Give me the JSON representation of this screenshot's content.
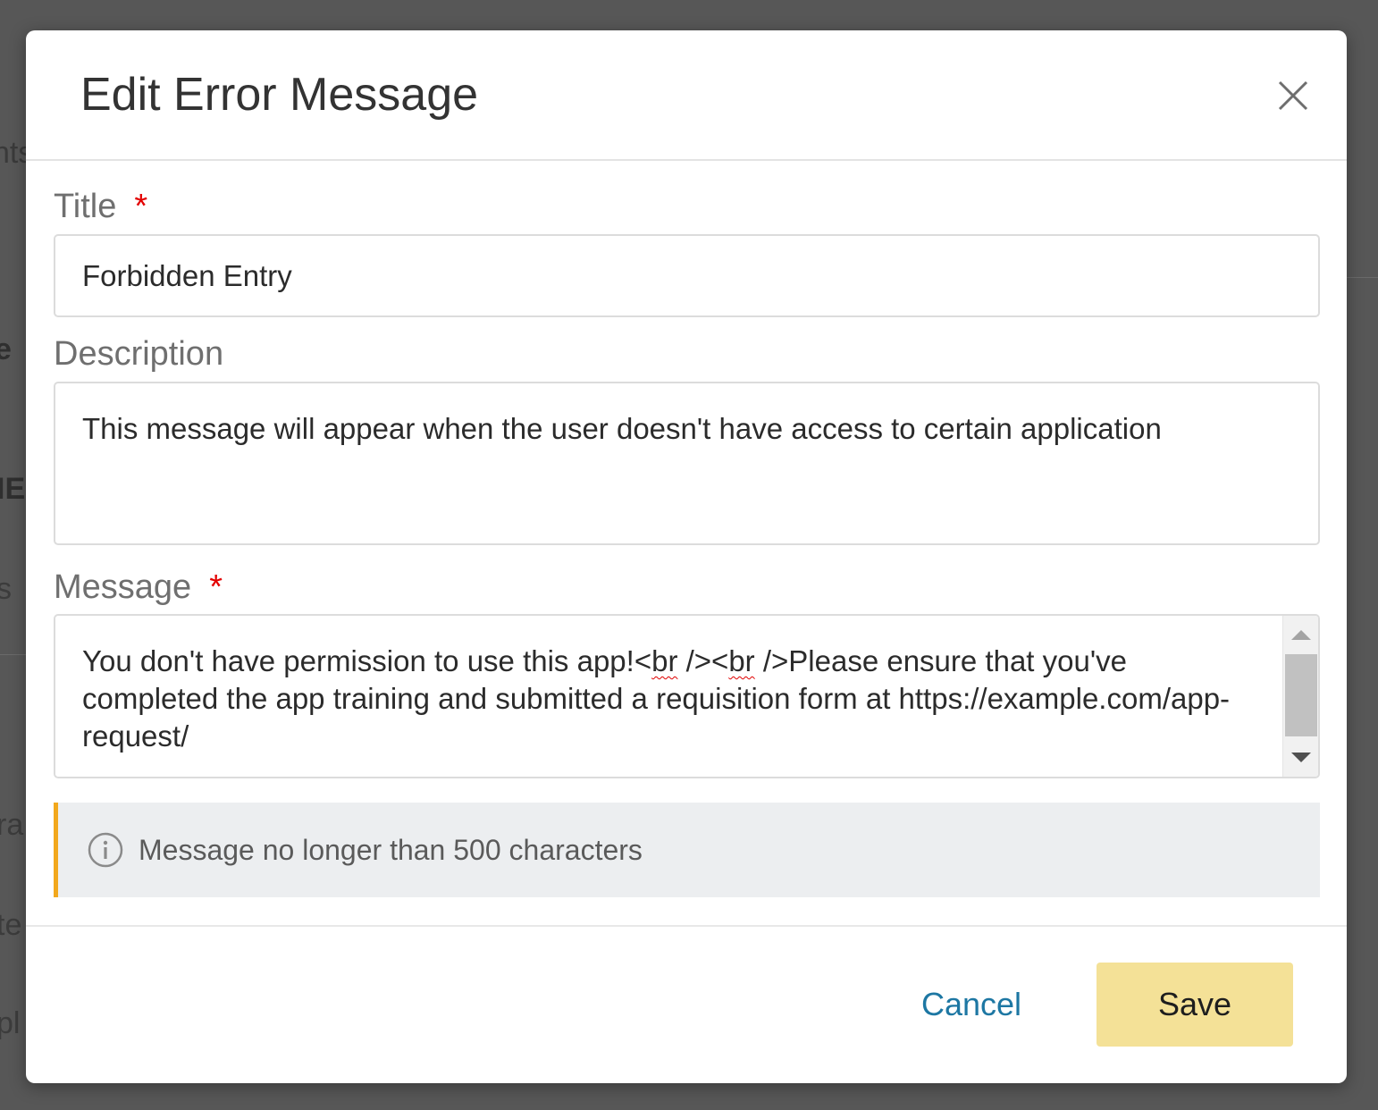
{
  "dialog": {
    "title": "Edit Error Message",
    "close_icon": "close-icon"
  },
  "form": {
    "title_field": {
      "label": "Title",
      "required_marker": "*",
      "value": "Forbidden Entry"
    },
    "description_field": {
      "label": "Description",
      "value": "This message will appear when the user doesn't have access to certain application"
    },
    "message_field": {
      "label": "Message",
      "required_marker": "*",
      "value_parts": [
        "You don't have permission to use this app!<",
        "br",
        " /><",
        "br",
        " />Please ensure that you've completed the app training and submitted a requisition form at https://example.com/app-request/"
      ]
    }
  },
  "info": {
    "icon": "info-icon",
    "text": "Message no longer than 500 characters",
    "accent_color": "#f2a81d"
  },
  "footer": {
    "cancel_label": "Cancel",
    "save_label": "Save",
    "save_color": "#f4e197",
    "cancel_color": "#1d77a3"
  }
}
